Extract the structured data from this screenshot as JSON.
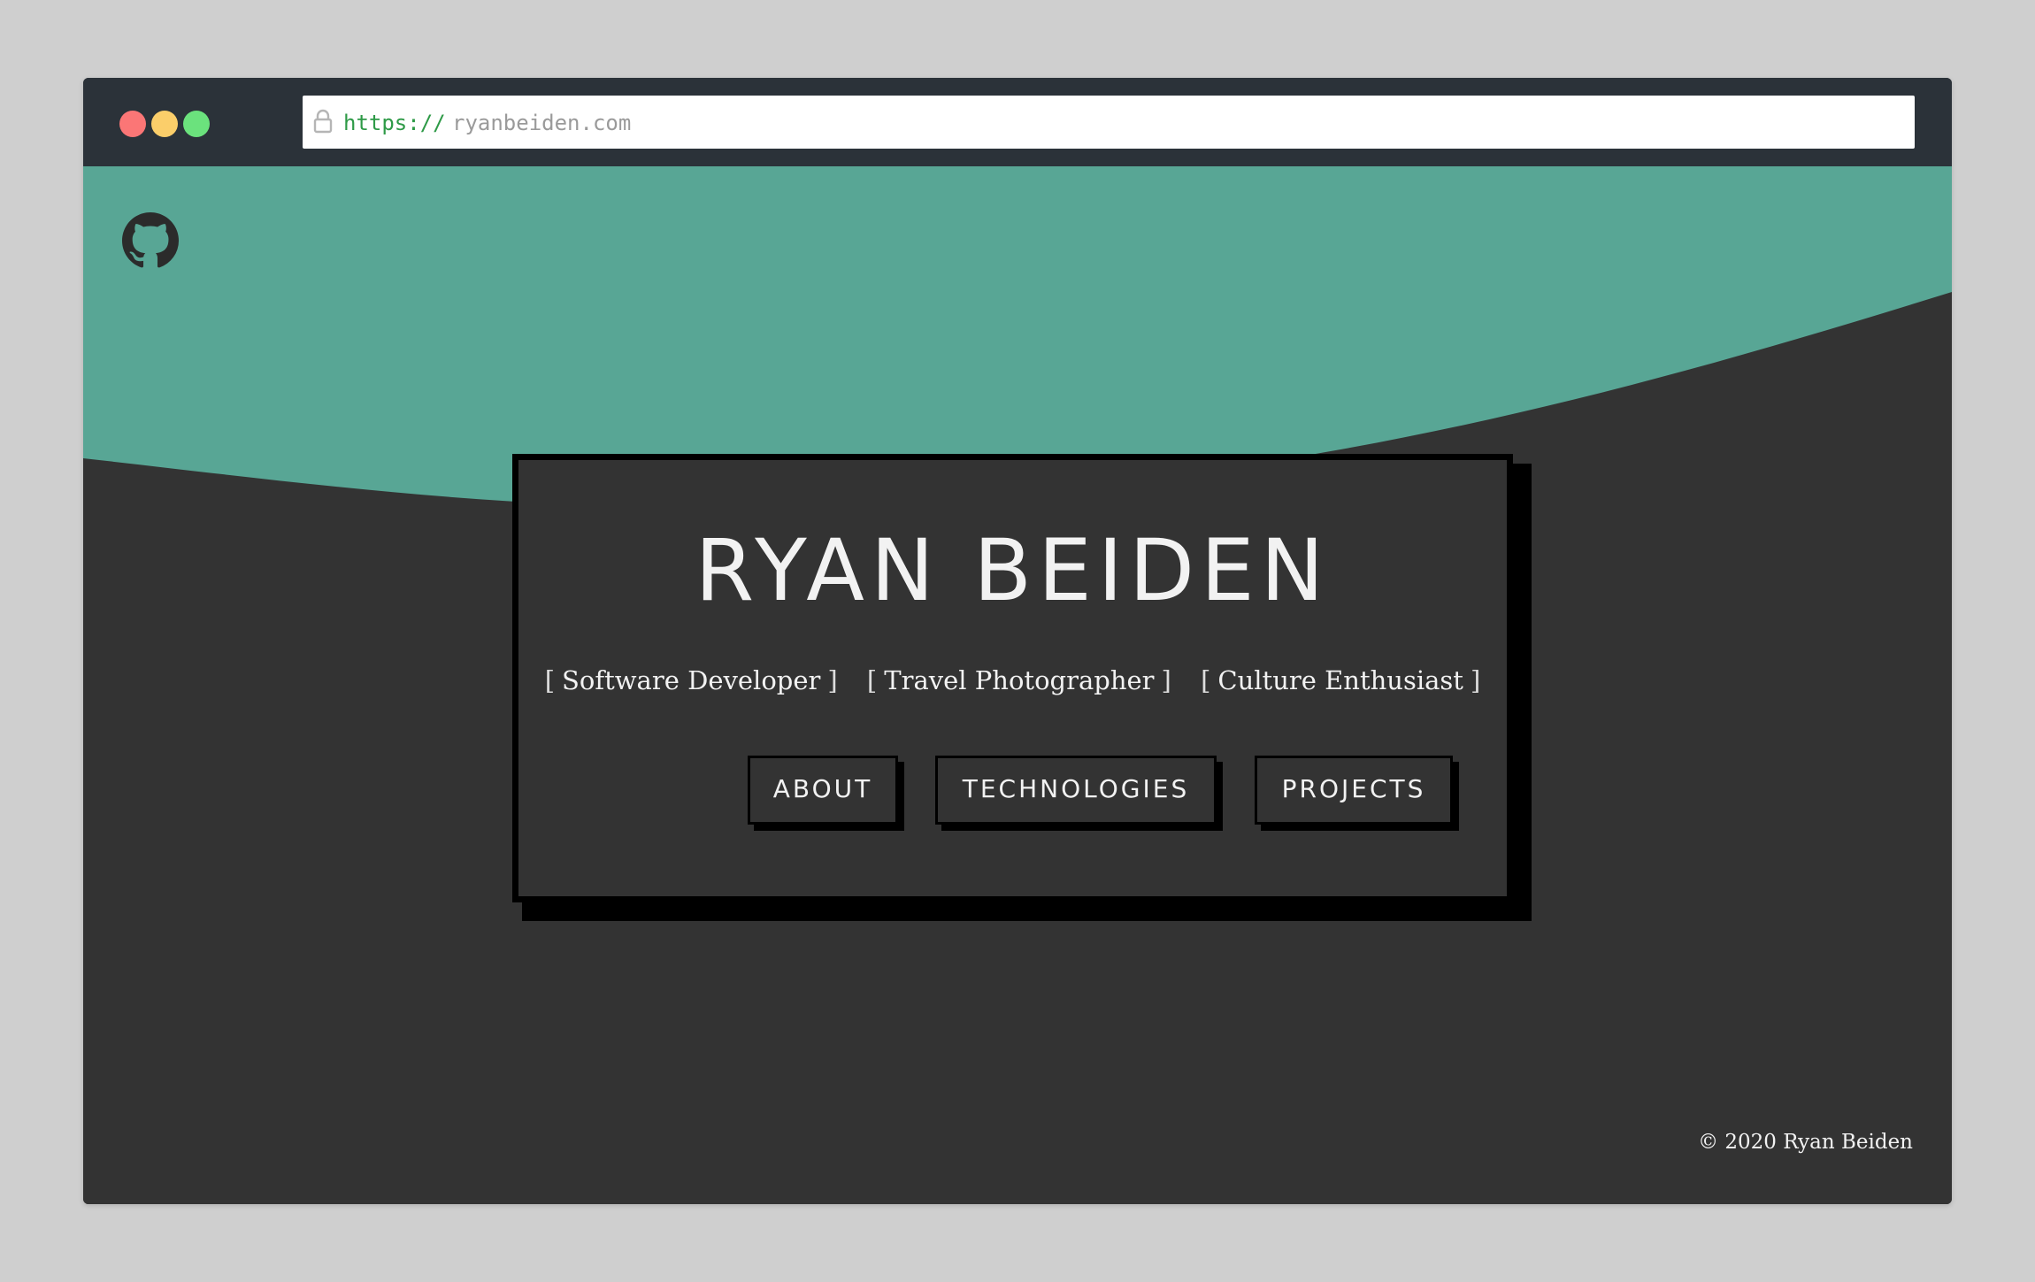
{
  "browser": {
    "url_scheme": "https://",
    "url_host": "ryanbeiden.com"
  },
  "colors": {
    "teal": "#58a695",
    "dark": "#333333",
    "titlebar": "#2b3239",
    "text": "#f2f2f2"
  },
  "header": {
    "github_icon": "github-icon"
  },
  "hero": {
    "title": "RYAN BEIDEN",
    "taglines": [
      "Software Developer",
      "Travel Photographer",
      "Culture Enthusiast"
    ],
    "bracket_open": "[",
    "bracket_close": "]",
    "buttons": [
      {
        "label": "ABOUT"
      },
      {
        "label": "TECHNOLOGIES"
      },
      {
        "label": "PROJECTS"
      }
    ]
  },
  "footer": {
    "copyright": "© 2020 Ryan Beiden"
  }
}
